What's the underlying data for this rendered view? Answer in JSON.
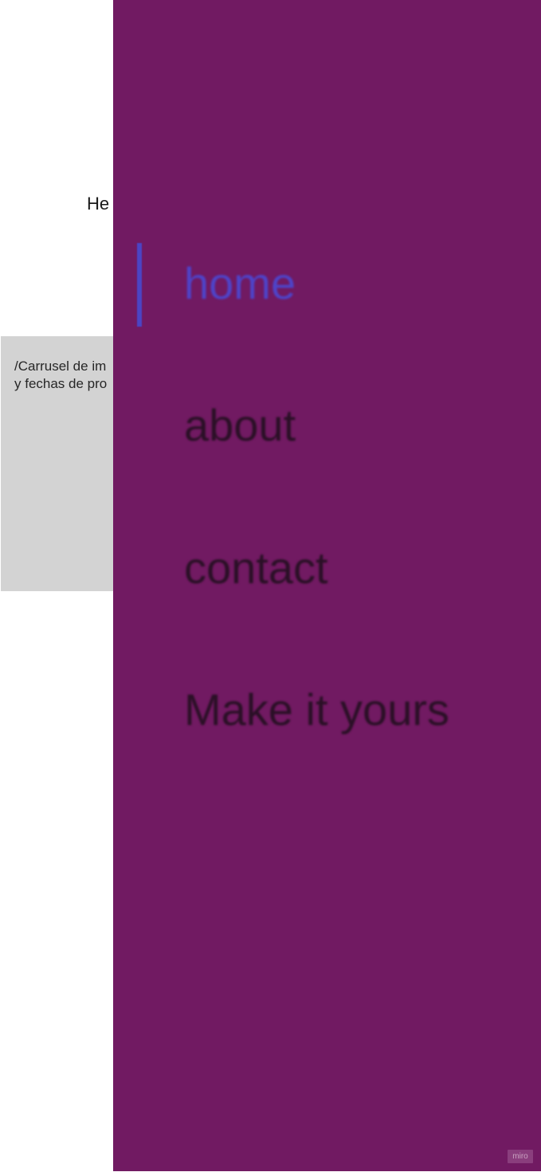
{
  "header": {
    "text_visible": "He"
  },
  "carousel": {
    "line1": "/Carrusel de im",
    "line2": "y fechas de pro"
  },
  "menu": {
    "background_color": "#711a62",
    "active_color": "#4e44c9",
    "inactive_color": "#2a1026",
    "items": [
      {
        "label": "home",
        "active": true
      },
      {
        "label": "about",
        "active": false
      },
      {
        "label": "contact",
        "active": false
      },
      {
        "label": "Make it yours",
        "active": false
      }
    ]
  },
  "badge": {
    "label": "miro"
  }
}
